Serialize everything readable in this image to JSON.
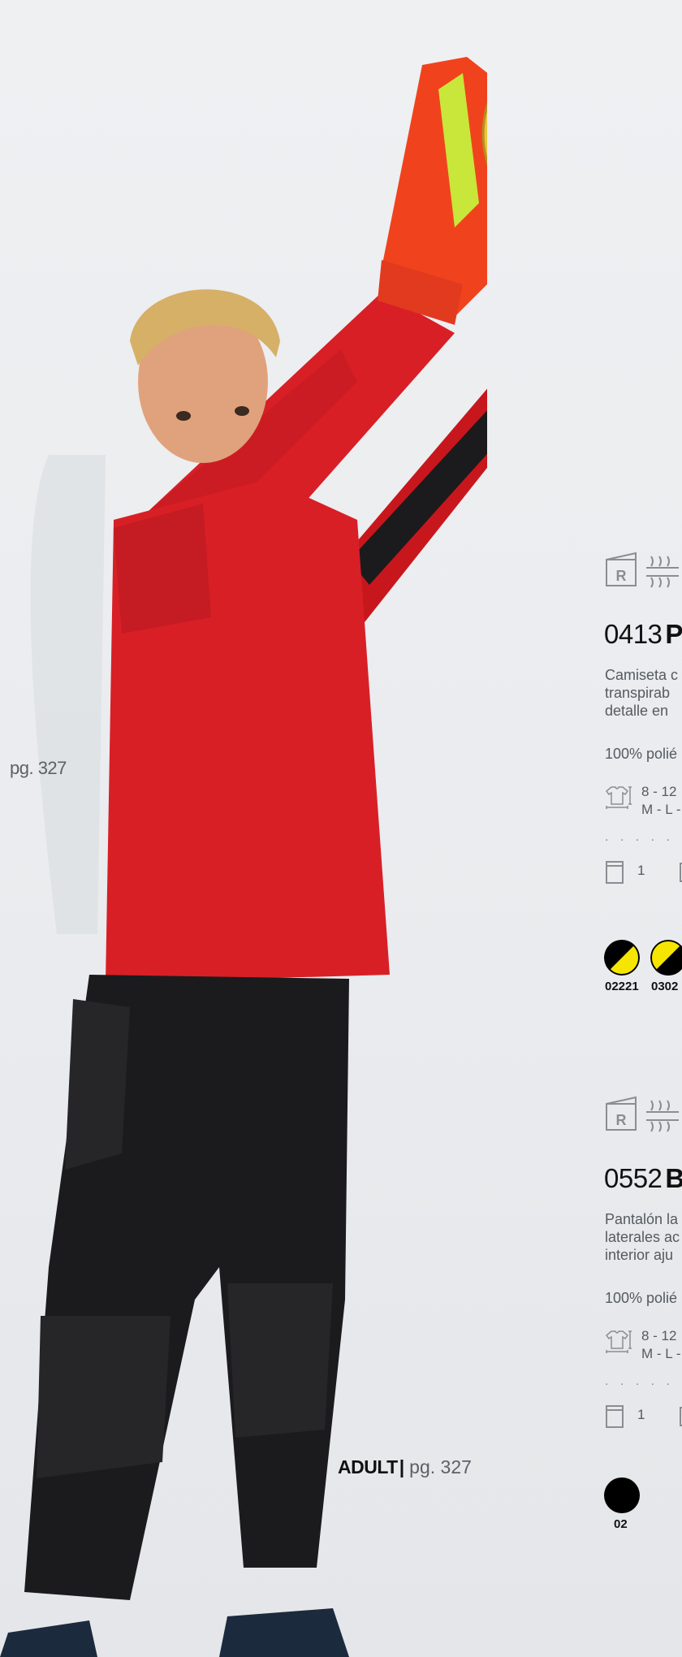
{
  "page_refs": {
    "left_page": "pg. 327",
    "adult_label": "ADULT",
    "adult_separator": "|",
    "adult_page": "pg. 327"
  },
  "products": [
    {
      "code": "0413",
      "name": "P",
      "description": [
        "Camiseta c",
        "transpirab",
        "detalle en"
      ],
      "composition": "100% polié",
      "sizes_line1": "8 - 12",
      "sizes_line2": "M - L -",
      "pack_qty": "1",
      "colors": [
        {
          "code": "02221",
          "primary": "#000000",
          "secondary": "#f6e500"
        },
        {
          "code": "0302",
          "primary": "#f6e500",
          "secondary": "#000000"
        }
      ]
    },
    {
      "code": "0552",
      "name": "B",
      "description": [
        "Pantalón la",
        "laterales ac",
        "interior aju"
      ],
      "composition": "100% polié",
      "sizes_line1": "8 - 12",
      "sizes_line2": "M - L -",
      "pack_qty": "1",
      "colors": [
        {
          "code": "02",
          "primary": "#000000",
          "secondary": "#000000"
        }
      ]
    }
  ],
  "dots": ". . . . . .",
  "palette": {
    "shirt_red": "#d81f26",
    "pants_black": "#1b1b1d",
    "ball_yellow": "#e9c53a",
    "text_grey": "#555a61"
  },
  "icons": [
    "wash-label-icon",
    "breathable-fabric-icon",
    "t-shirt-size-icon",
    "single-pack-icon",
    "box-pack-icon"
  ]
}
